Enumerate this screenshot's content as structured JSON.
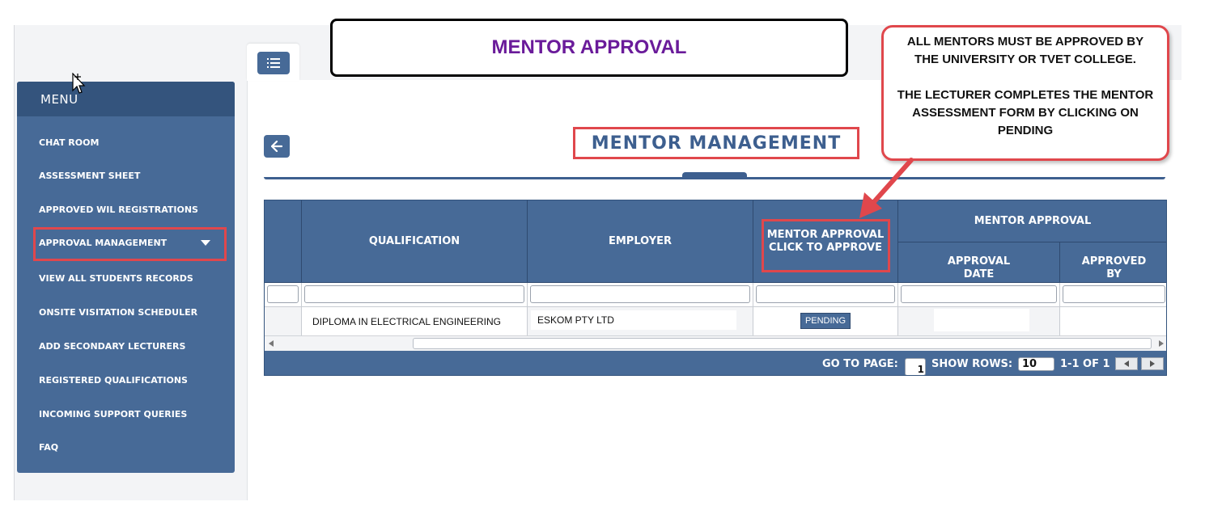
{
  "annotation": {
    "banner_title": "MENTOR APPROVAL",
    "callout_line1": "ALL MENTORS MUST BE APPROVED BY THE UNIVERSITY OR TVET COLLEGE.",
    "callout_line2": "THE LECTURER COMPLETES THE MENTOR ASSESSMENT FORM BY CLICKING ON PENDING"
  },
  "sidebar": {
    "title": "MENU",
    "items": [
      {
        "label": "CHAT ROOM"
      },
      {
        "label": "ASSESSMENT SHEET"
      },
      {
        "label": "APPROVED WIL REGISTRATIONS"
      },
      {
        "label": "APPROVAL MANAGEMENT"
      },
      {
        "label": "VIEW ALL STUDENTS RECORDS"
      },
      {
        "label": "ONSITE VISITATION SCHEDULER"
      },
      {
        "label": "ADD SECONDARY LECTURERS"
      },
      {
        "label": "REGISTERED QUALIFICATIONS"
      },
      {
        "label": "INCOMING SUPPORT QUERIES"
      },
      {
        "label": "FAQ"
      }
    ]
  },
  "main": {
    "page_title": "MENTOR MANAGEMENT"
  },
  "grid": {
    "columns": {
      "qualification": "QUALIFICATION",
      "employer": "EMPLOYER",
      "mentor_approval_click_line1": "MENTOR APPROVAL",
      "mentor_approval_click_line2": "CLICK TO APPROVE",
      "mentor_approval_group": "MENTOR APPROVAL",
      "approval_date_line1": "APPROVAL",
      "approval_date_line2": "DATE",
      "approved_by_line1": "APPROVED",
      "approved_by_line2": "BY"
    },
    "rows": [
      {
        "qualification": "DIPLOMA IN ELECTRICAL ENGINEERING",
        "employer": "ESKOM PTY LTD",
        "action": "PENDING",
        "approval_date": "",
        "approved_by": ""
      }
    ]
  },
  "pager": {
    "go_to_page_label": "GO TO PAGE:",
    "page_value": "1",
    "show_rows_label": "SHOW ROWS:",
    "rows_value": "10",
    "range_text": "1-1 OF 1"
  },
  "colors": {
    "primary": "#476a97",
    "header_dark": "#34547d",
    "highlight": "#e0474c",
    "banner_text": "#6a1b9a"
  }
}
